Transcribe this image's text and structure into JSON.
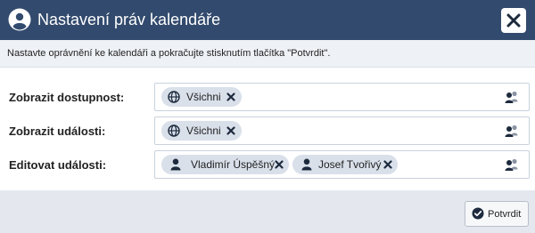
{
  "dialog": {
    "title": "Nastavení práv kalendáře",
    "instruction": "Nastavte oprávnění ke kalendáři a pokračujte stisknutím tlačítka \"Potvrdit\".",
    "colors": {
      "titlebar": "#324a6d",
      "infobar": "#eef1f6",
      "chip": "#d9e0ea",
      "footer": "#e4e8ee"
    }
  },
  "rows": [
    {
      "label": "Zobrazit dostupnost:",
      "chips": [
        {
          "icon": "globe-icon",
          "label": "Všichni"
        }
      ]
    },
    {
      "label": "Zobrazit události:",
      "chips": [
        {
          "icon": "globe-icon",
          "label": "Všichni"
        }
      ]
    },
    {
      "label": "Editovat události:",
      "chips": [
        {
          "icon": "user-icon",
          "label": "Vladimír Úspěšný"
        },
        {
          "icon": "user-icon",
          "label": "Josef Tvořivý"
        }
      ]
    }
  ],
  "footer": {
    "confirm_label": "Potvrdit"
  }
}
